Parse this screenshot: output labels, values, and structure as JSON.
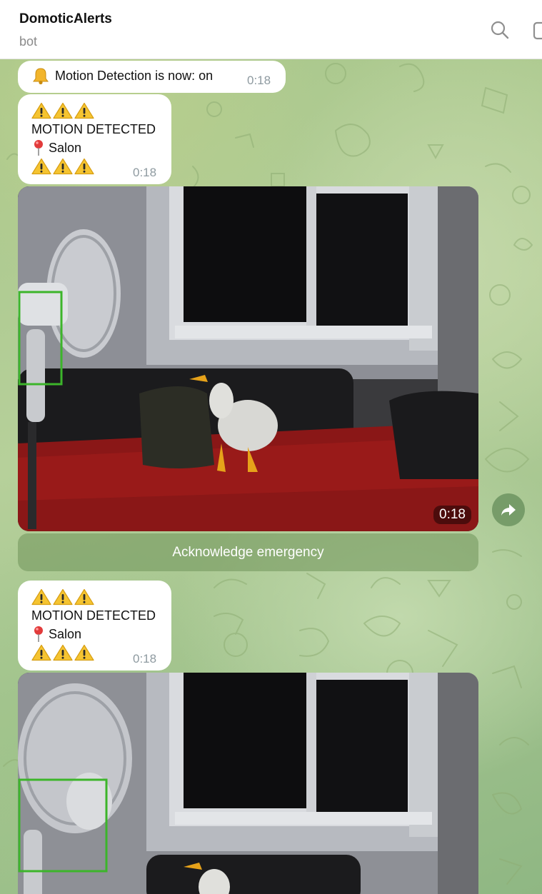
{
  "header": {
    "title": "DomoticAlerts",
    "subtitle": "bot",
    "icons": [
      "search-icon",
      "more-icon"
    ]
  },
  "messages": [
    {
      "type": "text",
      "icon": "bell-icon",
      "text": "Motion Detection is now: on",
      "time": "0:18"
    },
    {
      "type": "alert",
      "warning_icon": "warning-icon",
      "line1": "MOTION DETECTED",
      "pin_icon": "pin-icon",
      "location": "Salon",
      "time": "0:18"
    },
    {
      "type": "video",
      "duration": "0:18",
      "button_label": "Acknowledge emergency"
    },
    {
      "type": "alert",
      "warning_icon": "warning-icon",
      "line1": "MOTION DETECTED",
      "pin_icon": "pin-icon",
      "location": "Salon",
      "time": "0:18"
    },
    {
      "type": "video"
    }
  ],
  "colors": {
    "accent_green": "#3cb52a",
    "bubble": "#ffffff",
    "time_gray": "#8e9aa0"
  }
}
